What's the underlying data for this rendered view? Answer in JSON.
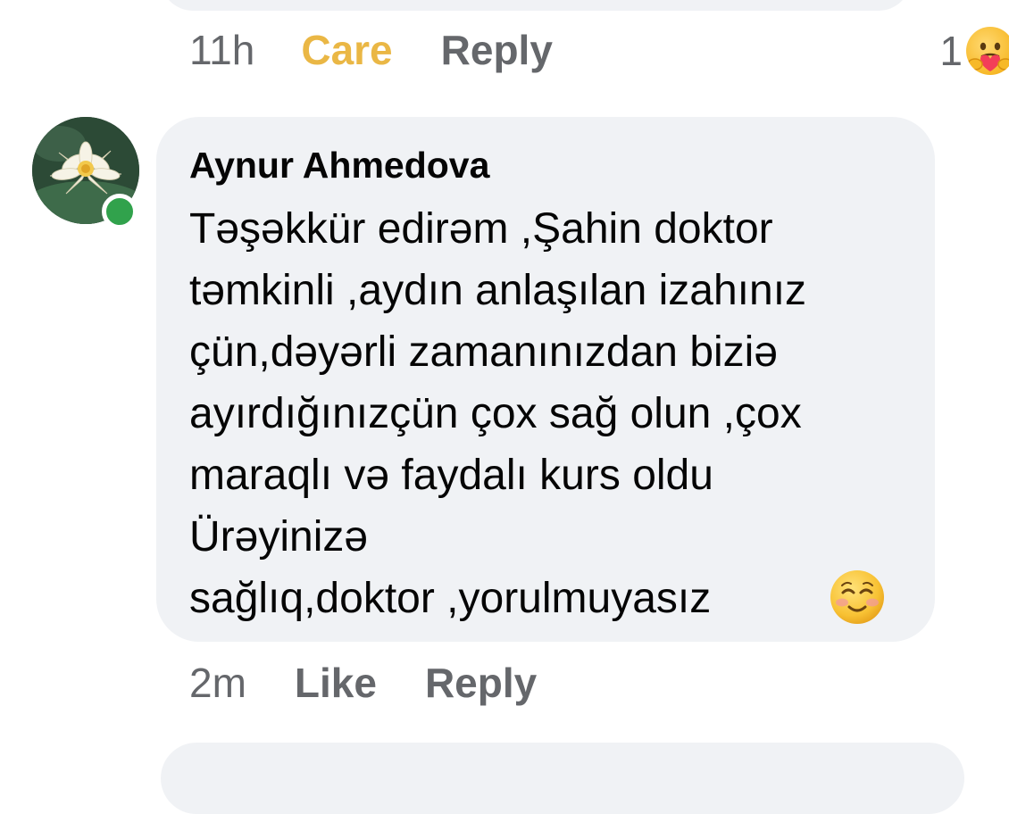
{
  "previous_comment": {
    "time": "11h",
    "reaction_label": "Care",
    "reply_label": "Reply",
    "reaction_count": "1",
    "reaction_icon": "care-emoji-icon",
    "care_color": "#eab745"
  },
  "comment": {
    "author": "Aynur Ahmedova",
    "avatar_icon": "water-lily-avatar",
    "online_color": "#31a24c",
    "text": "Təşəkkür  edirəm ,Şahin doktor\ntəmkinli ,aydın anlaşılan izahınız\nçün,dəyərli zamanınızdan biziə\nayırdığınızçün çox sağ olun ,çox\nmaraqlı və faydalı kurs oldu\nÜrəyinizə\nsağlıq,doktor ,yorulmuyasız",
    "emoji": "smiling-face-emoji-icon",
    "time": "2m",
    "like_label": "Like",
    "reply_label": "Reply"
  },
  "colors": {
    "bubble": "#f0f2f5",
    "secondary_text": "#65676b",
    "primary_text": "#050505"
  }
}
